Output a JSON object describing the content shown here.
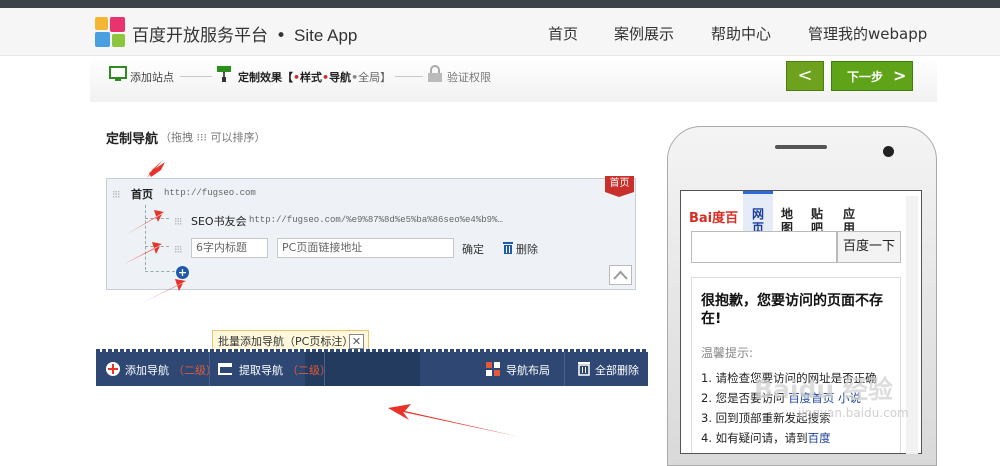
{
  "header": {
    "brand_name": "百度开放服务平台",
    "brand_dot": "•",
    "brand_sub": "Site App",
    "nav": [
      "首页",
      "案例展示",
      "帮助中心",
      "管理我的webapp"
    ]
  },
  "steps": {
    "step1": "添加站点",
    "step2_prefix": "定制效果【",
    "step2_style": "样式",
    "step2_nav": "导航",
    "step2_global": "全局】",
    "step3": "验证权限",
    "prev_icon": "<",
    "next_label": "下一步",
    "next_icon": ">"
  },
  "section": {
    "title": "定制导航",
    "hint": "（拖拽 ⁝⁝⁝ 可以排序）"
  },
  "nav_editor": {
    "root_label": "首页",
    "root_url": "http://fugseo.com",
    "badge": "首页",
    "child_label": "SEO书友会",
    "child_url": "http://fugseo.com/%e9%87%8d%e5%ba%86seo%e4%b9%…",
    "input_title_placeholder": "6字内标题",
    "input_url_placeholder": "PC页面链接地址",
    "confirm_label": "确定",
    "delete_label": "删除",
    "grip_icon": "⁝⁝⁝",
    "add_icon": "+"
  },
  "tooltip": {
    "text": "批量添加导航（PC页标注）",
    "close": "✕"
  },
  "toolbar": {
    "add_nav": "添加导航",
    "add_nav_level": "（二级）",
    "extract_nav": "提取导航",
    "extract_nav_level": "（二级）",
    "layout": "导航布局",
    "delete_all": "全部删除"
  },
  "phone": {
    "logo": "Bai度百",
    "tabs": [
      "网页",
      "地图",
      "贴吧",
      "应用"
    ],
    "search_button": "百度一下",
    "error_title": "很抱歉，您要访问的页面不存在!",
    "hint": "温馨提示:",
    "tip1": "1. 请检查您要访问的网址是否正确",
    "tip2_a": "2. 您是否要访问",
    "tip2_b": "百度首页",
    "tip2_c": "小说",
    "tip3": "3. 回到顶部重新发起搜索",
    "tip4": "4. 如有疑问请，请到",
    "tip4_link": "百度"
  },
  "watermark": {
    "text": "Baidu 经验",
    "url": "jingyan.baidu.com"
  },
  "colors": {
    "accent_green": "#5ea318",
    "toolbar_blue": "#2e4873",
    "red": "#c9302c",
    "link_blue": "#1e5aa8"
  }
}
